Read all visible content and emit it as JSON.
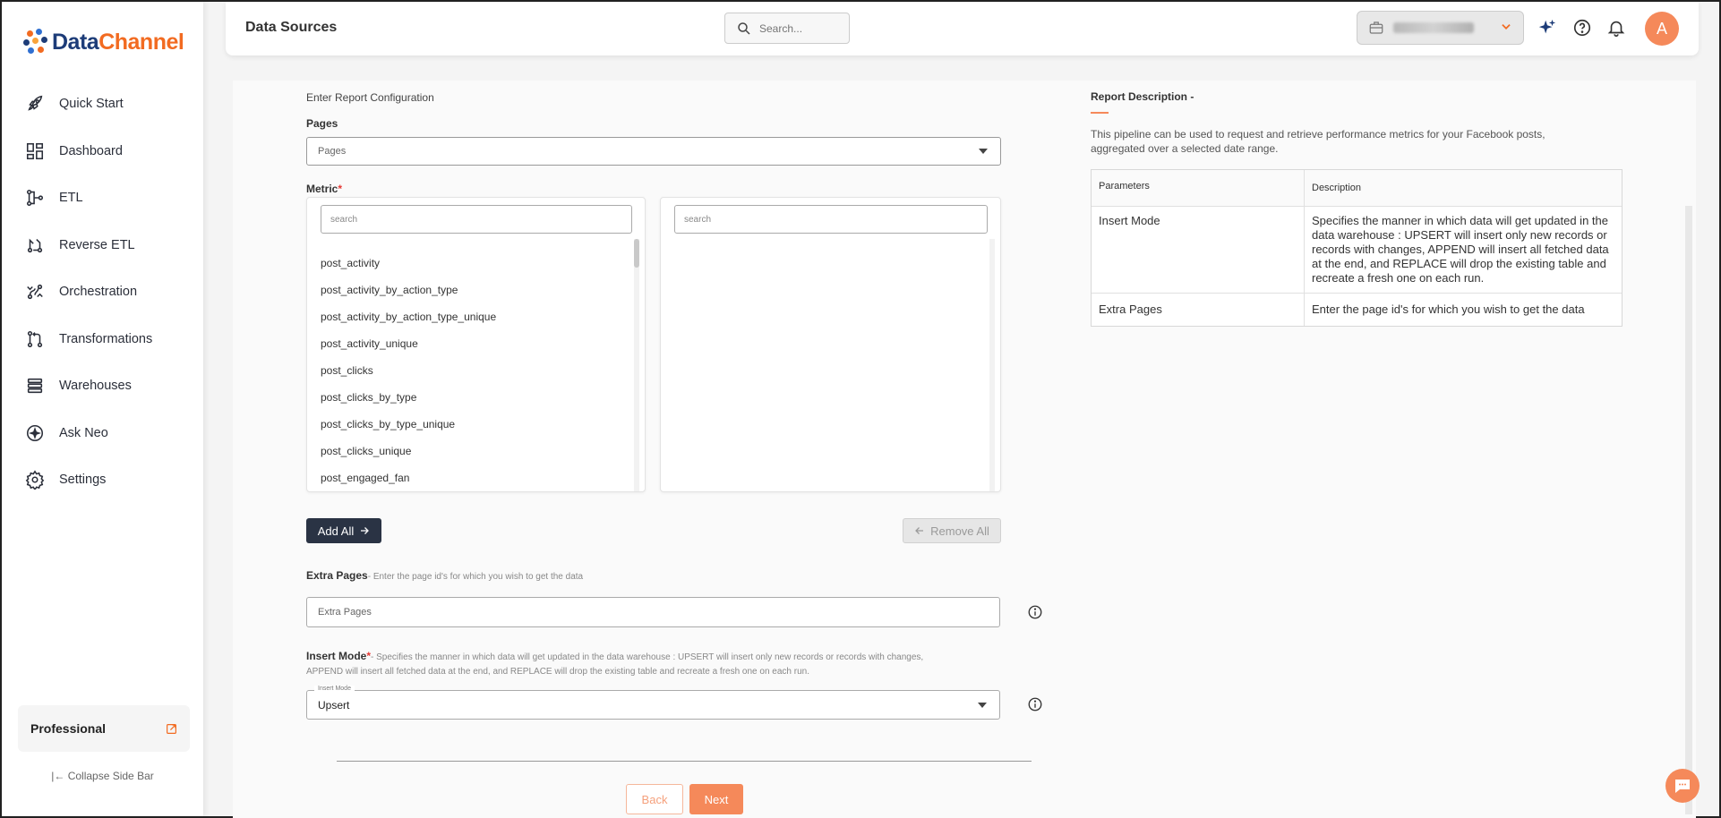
{
  "brand": {
    "name_part1": "Data",
    "name_part2": "Channel"
  },
  "sidebar": {
    "items": [
      {
        "label": "Quick Start",
        "icon": "rocket-icon"
      },
      {
        "label": "Dashboard",
        "icon": "dashboard-icon"
      },
      {
        "label": "ETL",
        "icon": "etl-icon"
      },
      {
        "label": "Reverse ETL",
        "icon": "reverse-etl-icon"
      },
      {
        "label": "Orchestration",
        "icon": "orchestration-icon"
      },
      {
        "label": "Transformations",
        "icon": "transformations-icon"
      },
      {
        "label": "Warehouses",
        "icon": "warehouses-icon"
      },
      {
        "label": "Ask Neo",
        "icon": "sparkle-icon"
      },
      {
        "label": "Settings",
        "icon": "gear-icon"
      }
    ],
    "plan": "Professional",
    "collapse_label": "Collapse Side Bar"
  },
  "header": {
    "title": "Data Sources",
    "search_placeholder": "Search...",
    "avatar_initial": "A"
  },
  "form": {
    "section_title": "Enter Report Configuration",
    "pages_label": "Pages",
    "pages_placeholder": "Pages",
    "metric_label": "Metric",
    "required_mark": "*",
    "available_search_placeholder": "search",
    "selected_search_placeholder": "search",
    "available_metrics": [
      "post_activity",
      "post_activity_by_action_type",
      "post_activity_by_action_type_unique",
      "post_activity_unique",
      "post_clicks",
      "post_clicks_by_type",
      "post_clicks_by_type_unique",
      "post_clicks_unique",
      "post_engaged_fan"
    ],
    "add_all_label": "Add All",
    "remove_all_label": "Remove All",
    "extra_pages_label": "Extra Pages",
    "extra_pages_hint": "- Enter the page id's for which you wish to get the data",
    "extra_pages_placeholder": "Extra Pages",
    "insert_mode_label": "Insert Mode",
    "insert_mode_hint": "- Specifies the manner in which data will get updated in the data warehouse : UPSERT will insert only new records or records with changes, APPEND will insert all fetched data at the end, and REPLACE will drop the existing table and recreate a fresh one on each run.",
    "insert_mode_float_label": "Insert Mode",
    "insert_mode_value": "Upsert",
    "back_label": "Back",
    "next_label": "Next"
  },
  "description": {
    "title": "Report Description -",
    "text": "This pipeline can be used to request and retrieve performance metrics for your Facebook posts, aggregated over a selected date range.",
    "table_headers": [
      "Parameters",
      "Description"
    ],
    "rows": [
      {
        "param": "Insert Mode",
        "desc": "Specifies the manner in which data will get updated in the data warehouse : UPSERT will insert only new records or records with changes, APPEND will insert all fetched data at the end, and REPLACE will drop the existing table and recreate a fresh one on each run."
      },
      {
        "param": "Extra Pages",
        "desc": "Enter the page id's for which you wish to get the data"
      }
    ]
  },
  "colors": {
    "accent": "#f5895a",
    "brand_blue": "#1d3c78",
    "brand_orange": "#f26b21",
    "dark_button": "#2a3344"
  }
}
